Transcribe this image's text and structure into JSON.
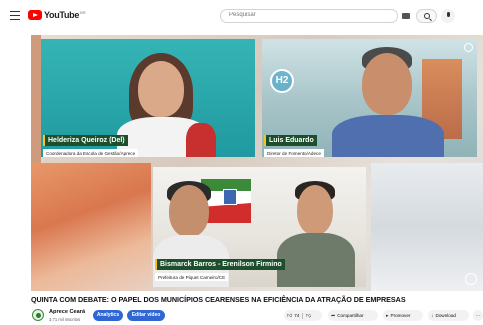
{
  "header": {
    "logo_text": "YouTube",
    "logo_sup": "BR",
    "search_placeholder": "Pesquisar"
  },
  "video": {
    "speakers": [
      {
        "name": "Helderiza Queiroz (Del)",
        "role": "Coordenadora da Escola de Gestão/Aprece"
      },
      {
        "name": "Luis Eduardo",
        "role": "Diretor de Fomento/Adece"
      },
      {
        "name": "Bismarck Barros - Erenilson Firmino",
        "role": "Prefeitura de Piquet Carneiro/CE"
      }
    ],
    "badge_text": "H2"
  },
  "title": "QUINTA COM DEBATE: O PAPEL DOS MUNICÍPIOS CEARENSES NA EFICIÊNCIA DA ATRAÇÃO DE EMPRESAS",
  "channel": {
    "name": "Aprece Ceará",
    "subscribers": "3,71 mil inscritos"
  },
  "buttons": {
    "analytics": "Analytics",
    "edit_video": "Editar vídeo",
    "like_count": "74",
    "share": "Compartilhar",
    "promote": "Promover",
    "download": "Download",
    "more": "···"
  },
  "colors": {
    "brand_red": "#ff0000",
    "name_tag_green": "#1e4f2d",
    "accent_yellow": "#f5c518",
    "primary_blue": "#2f66d4"
  }
}
